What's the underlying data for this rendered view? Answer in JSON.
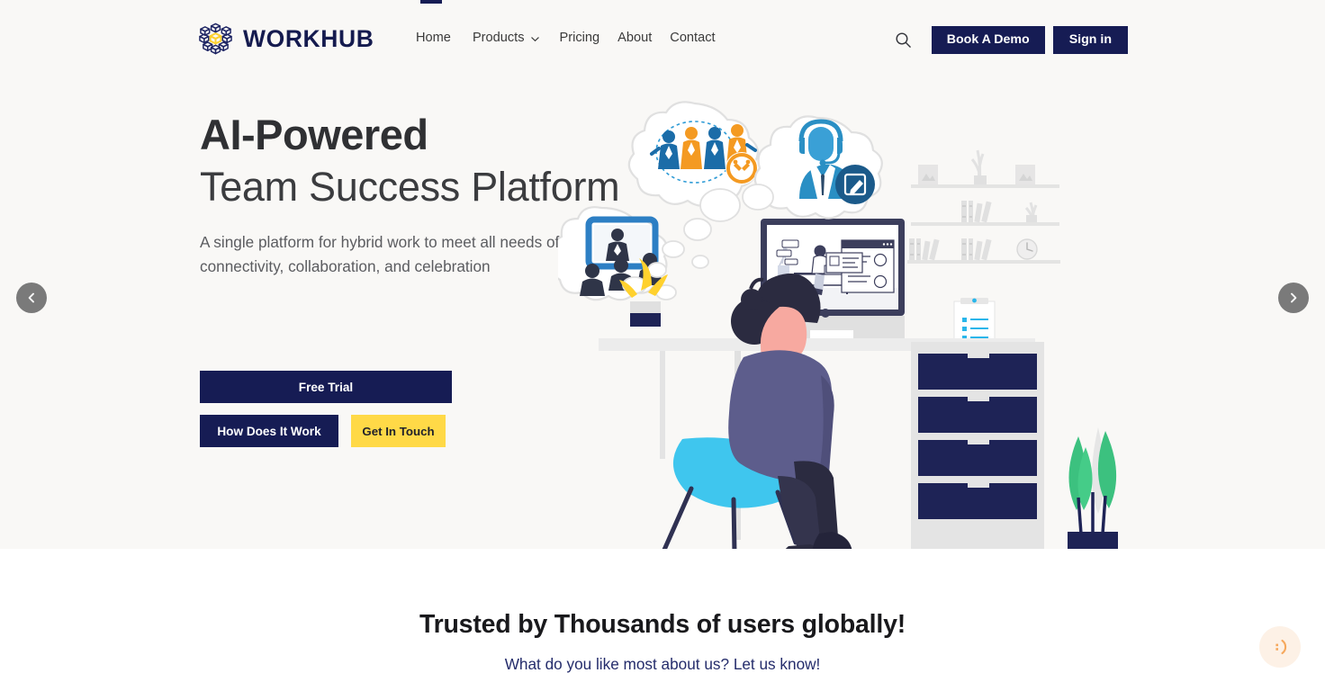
{
  "brand": {
    "name": "WORKHUB",
    "logo_icon": "cube-cluster-logo",
    "navy": "#161c54",
    "yellow": "#ffd947"
  },
  "header": {
    "nav": [
      {
        "label": "Home",
        "icon": null
      },
      {
        "label": "Products",
        "icon": "chevron-down-icon"
      },
      {
        "label": "Pricing",
        "icon": null
      },
      {
        "label": "About",
        "icon": null
      },
      {
        "label": "Contact",
        "icon": null
      }
    ],
    "search_icon": "search-icon",
    "book_demo_label": "Book A Demo",
    "sign_in_label": "Sign in"
  },
  "hero": {
    "title_bold": "AI-Powered",
    "title_light": "Team Success Platform",
    "subtitle": "A single platform for hybrid work to meet all needs of connectivity, collaboration, and celebration",
    "cta_primary": "Free Trial",
    "cta_secondary": "How Does It Work",
    "cta_tertiary": "Get In Touch",
    "background": "#f9f8f6",
    "illustration_alt": "woman-at-desk-illustration"
  },
  "carousel": {
    "prev_icon": "chevron-left-icon",
    "next_icon": "chevron-right-icon"
  },
  "trusted": {
    "heading": "Trusted by Thousands of users globally!",
    "subheading": "What do you like most about us? Let us know!",
    "subheading_color": "#242c6b"
  },
  "feedback": {
    "icon": "smiley-feedback-icon",
    "background": "#fdf1e6"
  }
}
